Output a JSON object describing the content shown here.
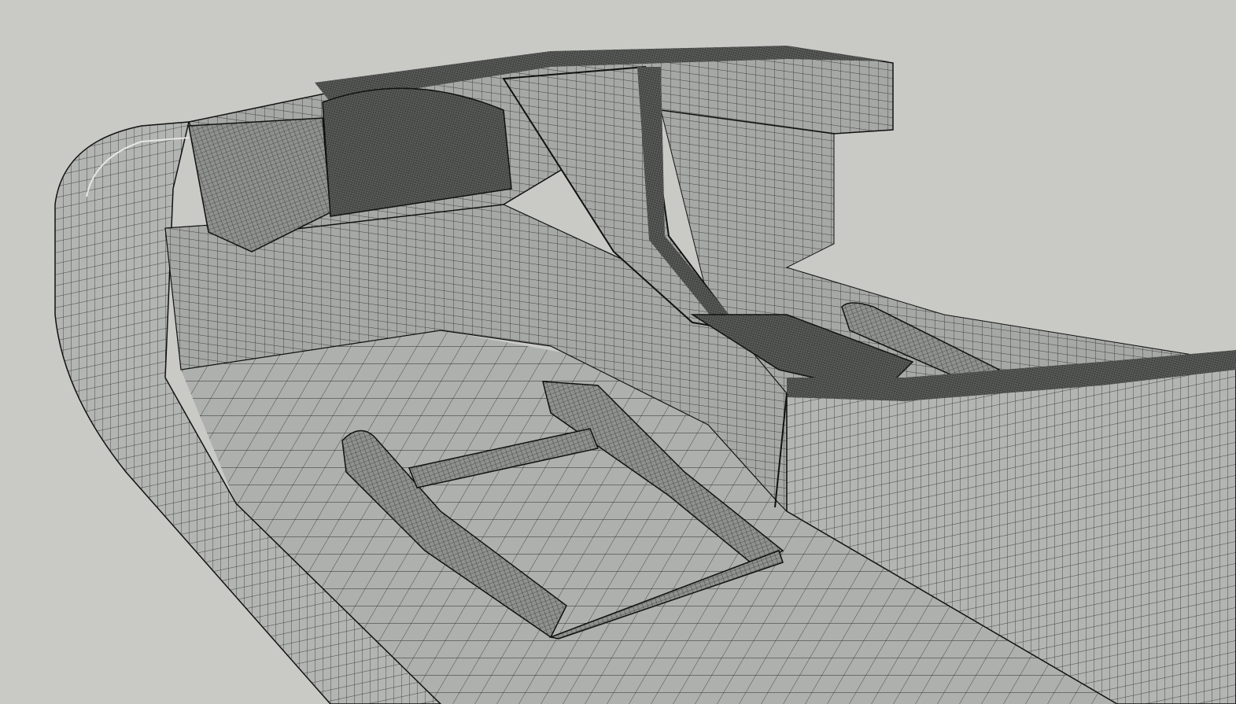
{
  "scene": {
    "subject": "car-interior-wireframe-render",
    "colors": {
      "background": "#c9c9c5",
      "surface": "#a9aba8",
      "surface_light": "#b9bbb8",
      "surface_dark": "#8c8e8b",
      "wire": "#1c1c1c",
      "dense_mesh": "#3a3a3a"
    }
  }
}
